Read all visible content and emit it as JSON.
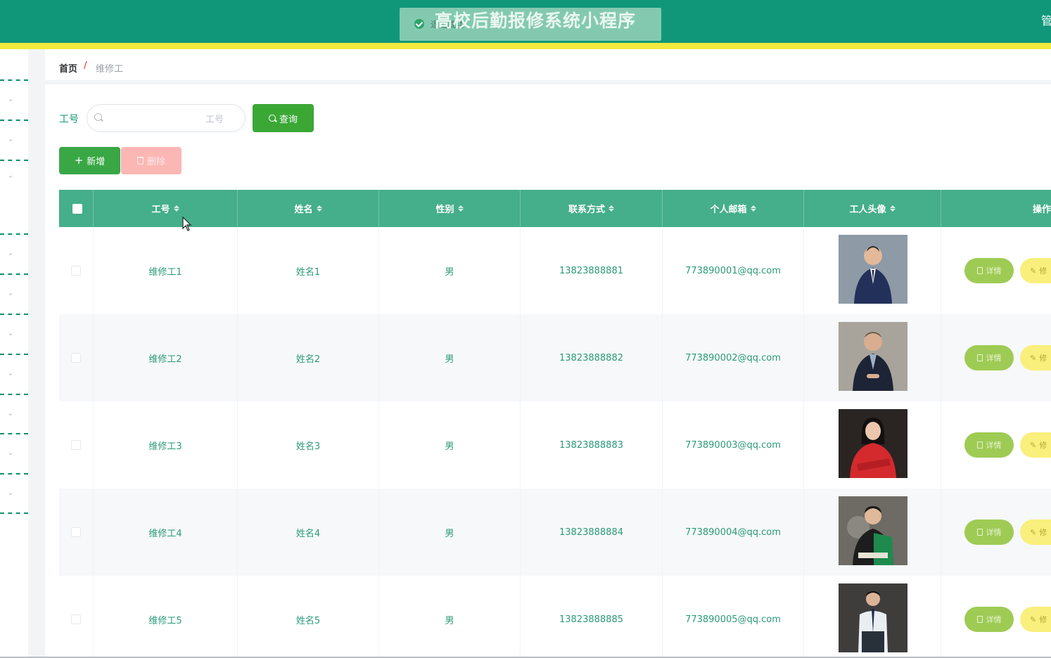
{
  "header": {
    "title": "高校后勤报修系统小程序",
    "toast": "退出成功",
    "user": "管",
    "colors": {
      "bar": "#10977a",
      "stripe": "#f2ea3e"
    }
  },
  "breadcrumb": {
    "home": "首页",
    "separator": "/",
    "current": "维修工"
  },
  "search": {
    "label": "工号",
    "placeholder": "工号",
    "query_button": "查询"
  },
  "actions": {
    "add": "新增",
    "delete": "删除"
  },
  "table": {
    "headers": [
      "工号",
      "姓名",
      "性别",
      "联系方式",
      "个人邮箱",
      "工人头像",
      "操作"
    ],
    "rows": [
      {
        "id": "维修工1",
        "name": "姓名1",
        "gender": "男",
        "phone": "13823888881",
        "email": "773890001@qq.com"
      },
      {
        "id": "维修工2",
        "name": "姓名2",
        "gender": "男",
        "phone": "13823888882",
        "email": "773890002@qq.com"
      },
      {
        "id": "维修工3",
        "name": "姓名3",
        "gender": "男",
        "phone": "13823888883",
        "email": "773890003@qq.com"
      },
      {
        "id": "维修工4",
        "name": "姓名4",
        "gender": "男",
        "phone": "13823888884",
        "email": "773890004@qq.com"
      },
      {
        "id": "维修工5",
        "name": "姓名5",
        "gender": "男",
        "phone": "13823888885",
        "email": "773890005@qq.com"
      }
    ],
    "row_actions": {
      "detail": "详情",
      "edit": "修"
    }
  }
}
